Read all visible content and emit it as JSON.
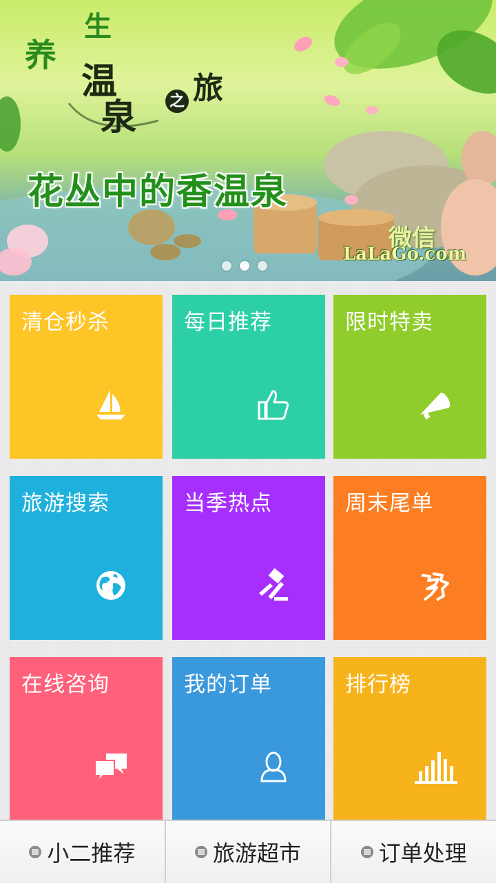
{
  "banner": {
    "title_chars": [
      "养",
      "生",
      "温",
      "泉",
      "之",
      "旅"
    ],
    "headline": "花丛中的香温泉",
    "watermark_cn": "微信",
    "watermark_url": "LaLaGo.com",
    "slides": 3,
    "active_slide": 2
  },
  "tiles": [
    {
      "label": "清仓秒杀",
      "icon": "sailboat-icon",
      "color": "#fec526"
    },
    {
      "label": "每日推荐",
      "icon": "thumbs-up-icon",
      "color": "#2ccfa6"
    },
    {
      "label": "限时特卖",
      "icon": "megaphone-icon",
      "color": "#8fcc2c"
    },
    {
      "label": "旅游搜索",
      "icon": "globe-icon",
      "color": "#1fb1de"
    },
    {
      "label": "当季热点",
      "icon": "gavel-icon",
      "color": "#a72ffd"
    },
    {
      "label": "周末尾单",
      "icon": "great-wall-icon",
      "color": "#fd7e22"
    },
    {
      "label": "在线咨询",
      "icon": "chat-bubbles-icon",
      "color": "#ff617b"
    },
    {
      "label": "我的订单",
      "icon": "user-icon",
      "color": "#3a98dc"
    },
    {
      "label": "排行榜",
      "icon": "bar-chart-icon",
      "color": "#f7b31b"
    }
  ],
  "bottom_nav": [
    {
      "label": "小二推荐",
      "icon": "menu-icon"
    },
    {
      "label": "旅游超市",
      "icon": "menu-icon"
    },
    {
      "label": "订单处理",
      "icon": "menu-icon"
    }
  ]
}
